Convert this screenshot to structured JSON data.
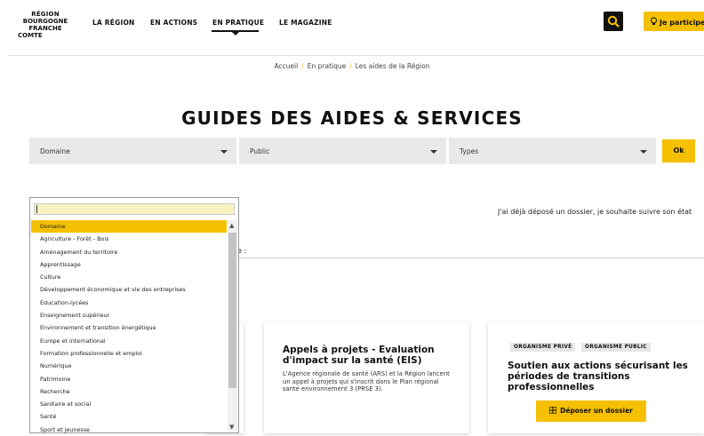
{
  "logo": {
    "line1": "RÉGION",
    "line2": "BOURGOGNE",
    "line3": "FRANCHE",
    "line4": "COMTE"
  },
  "nav": {
    "items": [
      "LA RÉGION",
      "EN ACTIONS",
      "EN PRATIQUE",
      "LE MAGAZINE"
    ],
    "active_index": 2
  },
  "header": {
    "participe_label": "Je participe"
  },
  "breadcrumb": [
    "Accueil",
    "En pratique",
    "Les aides de la Région"
  ],
  "page": {
    "title": "GUIDES DES AIDES & SERVICES"
  },
  "filters": {
    "domaine": "Domaine",
    "public": "Public",
    "types": "Types",
    "ok_label": "Ok"
  },
  "suivi_text": "J'ai déjà déposé un dossier, je souhaite suivre son état",
  "partial_label": "ne :",
  "dropdown": {
    "search_value": "",
    "items": [
      "Domaine",
      "Agriculture - Forêt - Bois",
      "Aménagement du territoire",
      "Apprentissage",
      "Culture",
      "Développement économique et vie des entreprises",
      "Education-lycées",
      "Enseignement supérieur",
      "Environnement et transition énergétique",
      "Europe et international",
      "Formation professionnelle et emploi",
      "Numérique",
      "Patrimoine",
      "Recherche",
      "Sanitaire et social",
      "Santé",
      "Sport et jeunesse"
    ],
    "selected_index": 0
  },
  "cards": {
    "mid": {
      "title": "Appels à projets - Evaluation d'impact sur la santé (EIS)",
      "description": "L'Agence régionale de santé (ARS) et la Région lancent un appel à projets qui s'inscrit dans le Plan régional santé environnement 3 (PRSE 3)."
    },
    "right": {
      "badges": [
        "ORGANISME PRIVÉ",
        "ORGANISME PUBLIC"
      ],
      "title": "Soutien aux actions sécurisant les périodes de transitions professionnelles",
      "button_label": "Déposer un dossier"
    }
  },
  "colors": {
    "accent": "#f5c000",
    "select_bg": "#e9e9e9",
    "dark": "#111111"
  },
  "icons": {
    "search": "search-icon",
    "participe": "lightbulb-icon",
    "depot": "grid-icon"
  }
}
